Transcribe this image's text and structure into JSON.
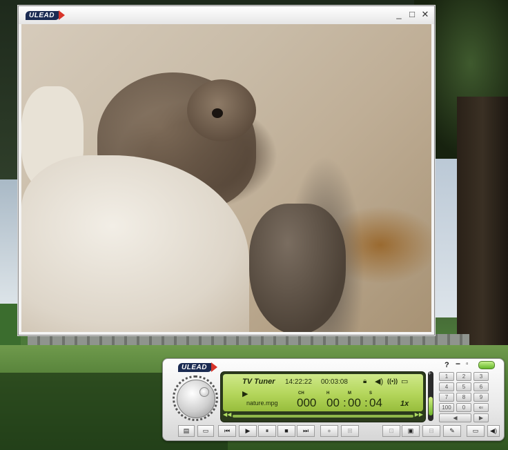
{
  "video_window": {
    "logo": "ULEAD",
    "controls": {
      "minimize": "_",
      "maximize": "□",
      "close": "✕"
    }
  },
  "tuner": {
    "logo": "ULEAD",
    "title_controls": {
      "help": "?",
      "minimize": "−",
      "restore": "▫"
    },
    "display": {
      "title": "TV Tuner",
      "clock": "14:22:22",
      "elapsed": "00:03:08",
      "filename": "nature.mpg",
      "labels": {
        "ch": "CH",
        "h": "H",
        "m": "M",
        "s": "S"
      },
      "channel": "000",
      "hours": "00",
      "minutes": "00",
      "seconds": "04",
      "speed": "1x"
    },
    "volume_level": 0.45,
    "keypad": [
      "1",
      "2",
      "3",
      "4",
      "5",
      "6",
      "7",
      "8",
      "9",
      "100",
      "0",
      "⇐"
    ],
    "icons": {
      "lock": "lock-icon",
      "speaker": "speaker-icon",
      "signal": "signal-icon",
      "folder": "folder-icon"
    }
  },
  "toolbar": {
    "buttons": [
      {
        "name": "open-file-button",
        "glyph": "▤",
        "enabled": true
      },
      {
        "name": "tv-input-button",
        "glyph": "▭",
        "enabled": true
      },
      {
        "name": "rewind-button",
        "glyph": "⏮",
        "enabled": true
      },
      {
        "name": "play-button",
        "glyph": "▶",
        "enabled": true
      },
      {
        "name": "pause-button",
        "glyph": "⏸",
        "enabled": true
      },
      {
        "name": "stop-button",
        "glyph": "■",
        "enabled": true
      },
      {
        "name": "fast-forward-button",
        "glyph": "⏭",
        "enabled": true
      },
      {
        "name": "record-button",
        "glyph": "●",
        "enabled": false
      },
      {
        "name": "schedule-button",
        "glyph": "⊞",
        "enabled": false
      },
      {
        "name": "snapshot-button",
        "glyph": "⊡",
        "enabled": false
      },
      {
        "name": "teletext-button",
        "glyph": "▣",
        "enabled": true
      },
      {
        "name": "tv-button",
        "glyph": "⊟",
        "enabled": false
      },
      {
        "name": "settings-button",
        "glyph": "✎",
        "enabled": true
      },
      {
        "name": "mode-button",
        "glyph": "▭",
        "enabled": true
      },
      {
        "name": "mute-button",
        "glyph": "◀)",
        "enabled": true
      }
    ]
  }
}
